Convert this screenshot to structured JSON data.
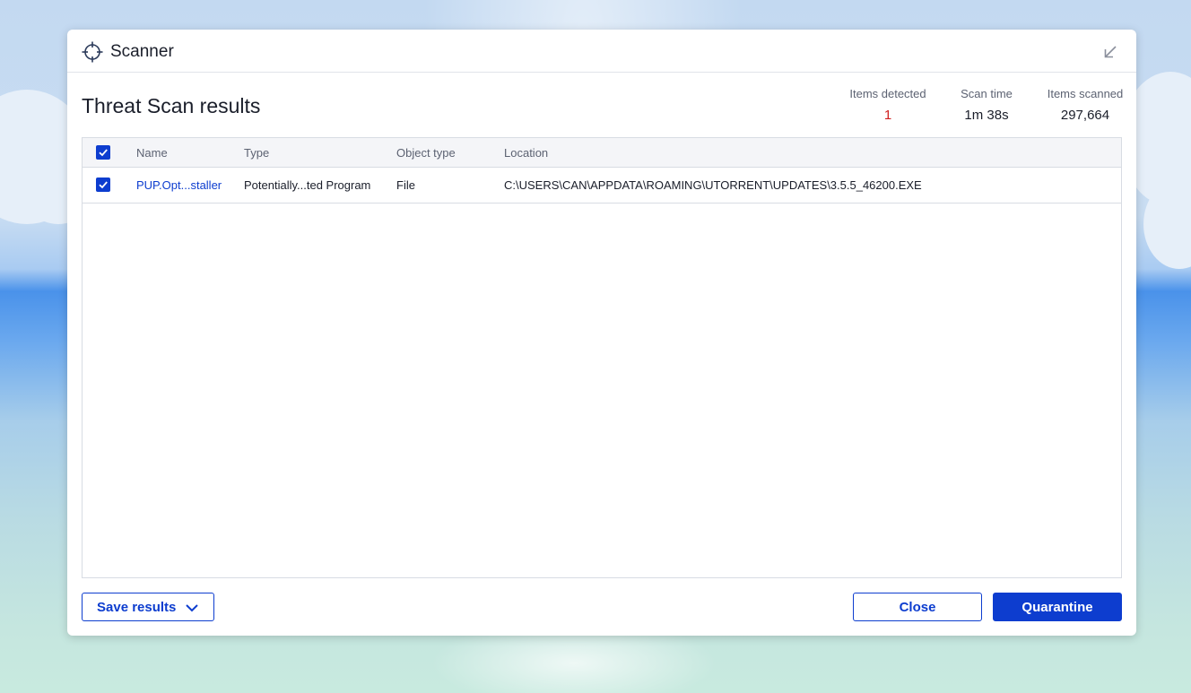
{
  "window": {
    "app_title": "Scanner",
    "app_icon": "crosshair-icon",
    "minimize_icon": "minimize-arrow-icon"
  },
  "header": {
    "title": "Threat Scan results"
  },
  "stats": [
    {
      "label": "Items detected",
      "value": "1",
      "color": "#d01f1f"
    },
    {
      "label": "Scan time",
      "value": "1m 38s"
    },
    {
      "label": "Items scanned",
      "value": "297,664"
    }
  ],
  "table": {
    "columns": [
      "Name",
      "Type",
      "Object type",
      "Location"
    ],
    "select_all_checked": true,
    "rows": [
      {
        "checked": true,
        "name": "PUP.Opt...staller",
        "type": "Potentially...ted Program",
        "object_type": "File",
        "location": "C:\\USERS\\CAN\\APPDATA\\ROAMING\\UTORRENT\\UPDATES\\3.5.5_46200.EXE"
      }
    ]
  },
  "footer": {
    "save_label": "Save results",
    "close_label": "Close",
    "quarantine_label": "Quarantine"
  },
  "colors": {
    "accent": "#0d3dcf",
    "detected": "#d01f1f"
  }
}
